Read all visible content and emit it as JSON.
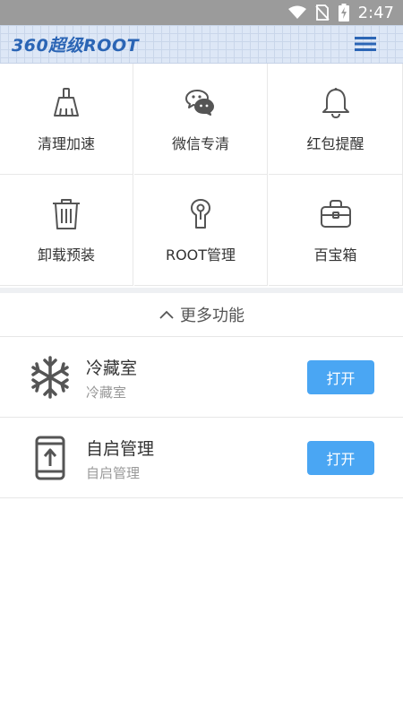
{
  "status_bar": {
    "time": "2:47"
  },
  "header": {
    "title": "360超级ROOT"
  },
  "tools": [
    {
      "label": "清理加速",
      "icon": "broom-icon"
    },
    {
      "label": "微信专清",
      "icon": "wechat-icon"
    },
    {
      "label": "红包提醒",
      "icon": "bell-icon"
    },
    {
      "label": "卸载预装",
      "icon": "trash-icon"
    },
    {
      "label": "ROOT管理",
      "icon": "keyhole-icon"
    },
    {
      "label": "百宝箱",
      "icon": "toolbox-icon"
    }
  ],
  "more": {
    "label": "更多功能"
  },
  "features": [
    {
      "title": "冷藏室",
      "subtitle": "冷藏室",
      "button": "打开",
      "icon": "snowflake-icon"
    },
    {
      "title": "自启管理",
      "subtitle": "自启管理",
      "button": "打开",
      "icon": "phone-upload-icon"
    }
  ],
  "colors": {
    "accent": "#4aa6f3",
    "header_title": "#2b65b5",
    "status_bar": "#9b9b9b"
  }
}
